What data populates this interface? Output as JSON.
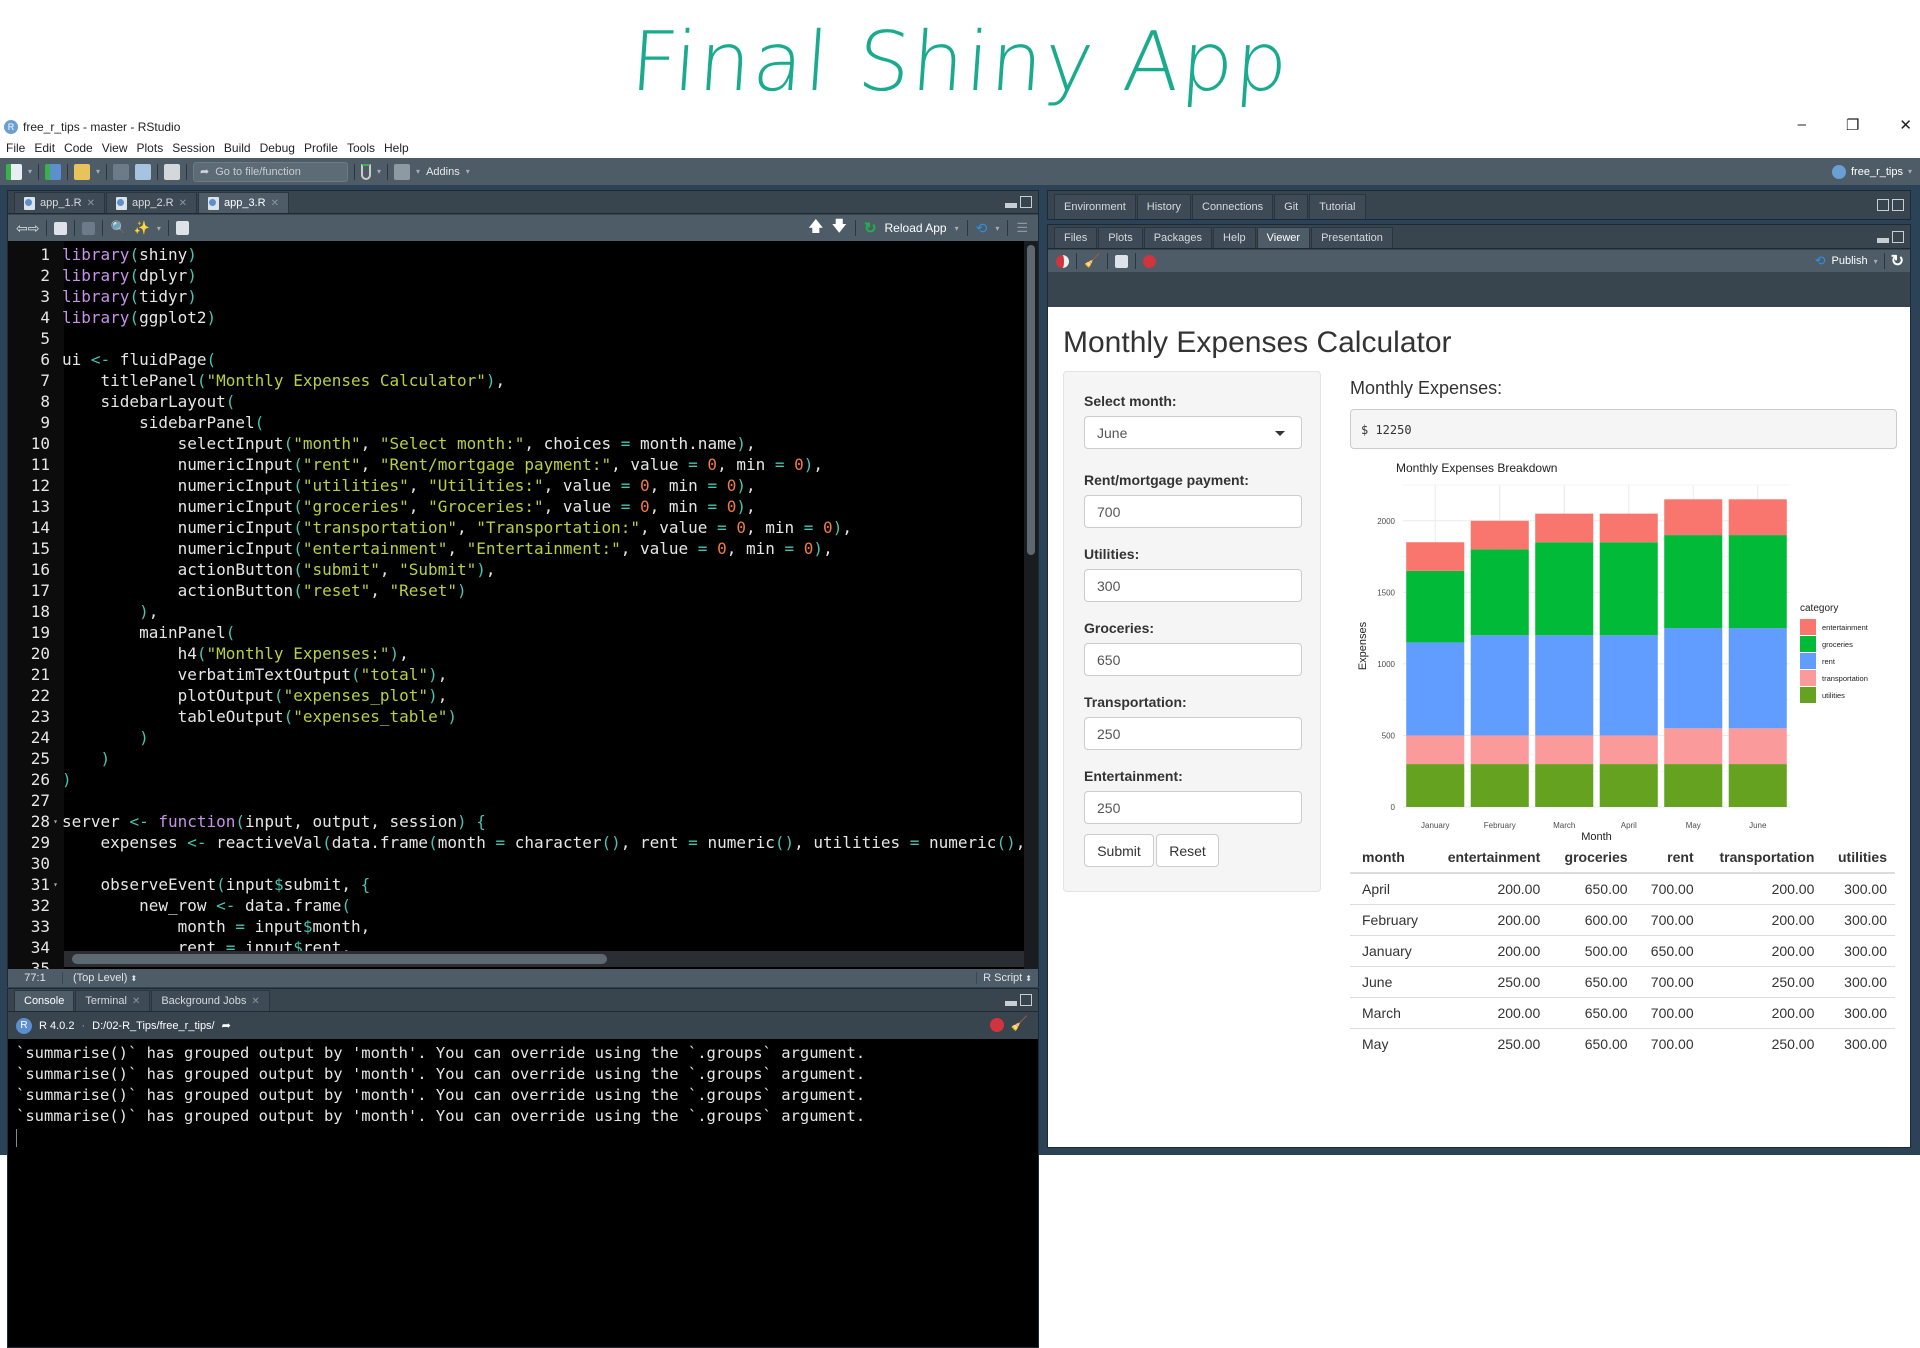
{
  "banner": {
    "text": "Final Shiny App"
  },
  "window": {
    "title": "free_r_tips - master - RStudio",
    "controls": {
      "minimize": "–",
      "restore": "❐",
      "close": "✕"
    }
  },
  "menu": [
    "File",
    "Edit",
    "Code",
    "View",
    "Plots",
    "Session",
    "Build",
    "Debug",
    "Profile",
    "Tools",
    "Help"
  ],
  "toolbar": {
    "goto_placeholder": "Go to file/function",
    "addins_label": "Addins",
    "project_label": "free_r_tips"
  },
  "editor": {
    "tabs": [
      {
        "label": "app_1.R",
        "active": false
      },
      {
        "label": "app_2.R",
        "active": false
      },
      {
        "label": "app_3.R",
        "active": true
      }
    ],
    "reload_label": "Reload App",
    "lines": [
      [
        [
          "kw",
          "library"
        ],
        [
          "pa",
          "("
        ],
        [
          "tx",
          "shiny"
        ],
        [
          "pa",
          ")"
        ]
      ],
      [
        [
          "kw",
          "library"
        ],
        [
          "pa",
          "("
        ],
        [
          "tx",
          "dplyr"
        ],
        [
          "pa",
          ")"
        ]
      ],
      [
        [
          "kw",
          "library"
        ],
        [
          "pa",
          "("
        ],
        [
          "tx",
          "tidyr"
        ],
        [
          "pa",
          ")"
        ]
      ],
      [
        [
          "kw",
          "library"
        ],
        [
          "pa",
          "("
        ],
        [
          "tx",
          "ggplot2"
        ],
        [
          "pa",
          ")"
        ]
      ],
      [],
      [
        [
          "tx",
          "ui "
        ],
        [
          "op",
          "<-"
        ],
        [
          "tx",
          " fluidPage"
        ],
        [
          "pa",
          "("
        ]
      ],
      [
        [
          "tx",
          "    titlePanel"
        ],
        [
          "pa",
          "("
        ],
        [
          "st",
          "\"Monthly Expenses Calculator\""
        ],
        [
          "pa",
          ")"
        ],
        [
          "tx",
          ","
        ]
      ],
      [
        [
          "tx",
          "    sidebarLayout"
        ],
        [
          "pa",
          "("
        ]
      ],
      [
        [
          "tx",
          "        sidebarPanel"
        ],
        [
          "pa",
          "("
        ]
      ],
      [
        [
          "tx",
          "            selectInput"
        ],
        [
          "pa",
          "("
        ],
        [
          "st",
          "\"month\""
        ],
        [
          "tx",
          ", "
        ],
        [
          "st",
          "\"Select month:\""
        ],
        [
          "tx",
          ", choices "
        ],
        [
          "op",
          "="
        ],
        [
          "tx",
          " month.name"
        ],
        [
          "pa",
          ")"
        ],
        [
          "tx",
          ","
        ]
      ],
      [
        [
          "tx",
          "            numericInput"
        ],
        [
          "pa",
          "("
        ],
        [
          "st",
          "\"rent\""
        ],
        [
          "tx",
          ", "
        ],
        [
          "st",
          "\"Rent/mortgage payment:\""
        ],
        [
          "tx",
          ", value "
        ],
        [
          "op",
          "="
        ],
        [
          "tx",
          " "
        ],
        [
          "nu",
          "0"
        ],
        [
          "tx",
          ", min "
        ],
        [
          "op",
          "="
        ],
        [
          "tx",
          " "
        ],
        [
          "nu",
          "0"
        ],
        [
          "pa",
          ")"
        ],
        [
          "tx",
          ","
        ]
      ],
      [
        [
          "tx",
          "            numericInput"
        ],
        [
          "pa",
          "("
        ],
        [
          "st",
          "\"utilities\""
        ],
        [
          "tx",
          ", "
        ],
        [
          "st",
          "\"Utilities:\""
        ],
        [
          "tx",
          ", value "
        ],
        [
          "op",
          "="
        ],
        [
          "tx",
          " "
        ],
        [
          "nu",
          "0"
        ],
        [
          "tx",
          ", min "
        ],
        [
          "op",
          "="
        ],
        [
          "tx",
          " "
        ],
        [
          "nu",
          "0"
        ],
        [
          "pa",
          ")"
        ],
        [
          "tx",
          ","
        ]
      ],
      [
        [
          "tx",
          "            numericInput"
        ],
        [
          "pa",
          "("
        ],
        [
          "st",
          "\"groceries\""
        ],
        [
          "tx",
          ", "
        ],
        [
          "st",
          "\"Groceries:\""
        ],
        [
          "tx",
          ", value "
        ],
        [
          "op",
          "="
        ],
        [
          "tx",
          " "
        ],
        [
          "nu",
          "0"
        ],
        [
          "tx",
          ", min "
        ],
        [
          "op",
          "="
        ],
        [
          "tx",
          " "
        ],
        [
          "nu",
          "0"
        ],
        [
          "pa",
          ")"
        ],
        [
          "tx",
          ","
        ]
      ],
      [
        [
          "tx",
          "            numericInput"
        ],
        [
          "pa",
          "("
        ],
        [
          "st",
          "\"transportation\""
        ],
        [
          "tx",
          ", "
        ],
        [
          "st",
          "\"Transportation:\""
        ],
        [
          "tx",
          ", value "
        ],
        [
          "op",
          "="
        ],
        [
          "tx",
          " "
        ],
        [
          "nu",
          "0"
        ],
        [
          "tx",
          ", min "
        ],
        [
          "op",
          "="
        ],
        [
          "tx",
          " "
        ],
        [
          "nu",
          "0"
        ],
        [
          "pa",
          ")"
        ],
        [
          "tx",
          ","
        ]
      ],
      [
        [
          "tx",
          "            numericInput"
        ],
        [
          "pa",
          "("
        ],
        [
          "st",
          "\"entertainment\""
        ],
        [
          "tx",
          ", "
        ],
        [
          "st",
          "\"Entertainment:\""
        ],
        [
          "tx",
          ", value "
        ],
        [
          "op",
          "="
        ],
        [
          "tx",
          " "
        ],
        [
          "nu",
          "0"
        ],
        [
          "tx",
          ", min "
        ],
        [
          "op",
          "="
        ],
        [
          "tx",
          " "
        ],
        [
          "nu",
          "0"
        ],
        [
          "pa",
          ")"
        ],
        [
          "tx",
          ","
        ]
      ],
      [
        [
          "tx",
          "            actionButton"
        ],
        [
          "pa",
          "("
        ],
        [
          "st",
          "\"submit\""
        ],
        [
          "tx",
          ", "
        ],
        [
          "st",
          "\"Submit\""
        ],
        [
          "pa",
          ")"
        ],
        [
          "tx",
          ","
        ]
      ],
      [
        [
          "tx",
          "            actionButton"
        ],
        [
          "pa",
          "("
        ],
        [
          "st",
          "\"reset\""
        ],
        [
          "tx",
          ", "
        ],
        [
          "st",
          "\"Reset\""
        ],
        [
          "pa",
          ")"
        ]
      ],
      [
        [
          "pa",
          "        )"
        ],
        [
          "tx",
          ","
        ]
      ],
      [
        [
          "tx",
          "        mainPanel"
        ],
        [
          "pa",
          "("
        ]
      ],
      [
        [
          "tx",
          "            h4"
        ],
        [
          "pa",
          "("
        ],
        [
          "st",
          "\"Monthly Expenses:\""
        ],
        [
          "pa",
          ")"
        ],
        [
          "tx",
          ","
        ]
      ],
      [
        [
          "tx",
          "            verbatimTextOutput"
        ],
        [
          "pa",
          "("
        ],
        [
          "st",
          "\"total\""
        ],
        [
          "pa",
          ")"
        ],
        [
          "tx",
          ","
        ]
      ],
      [
        [
          "tx",
          "            plotOutput"
        ],
        [
          "pa",
          "("
        ],
        [
          "st",
          "\"expenses_plot\""
        ],
        [
          "pa",
          ")"
        ],
        [
          "tx",
          ","
        ]
      ],
      [
        [
          "tx",
          "            tableOutput"
        ],
        [
          "pa",
          "("
        ],
        [
          "st",
          "\"expenses_table\""
        ],
        [
          "pa",
          ")"
        ]
      ],
      [
        [
          "pa",
          "        )"
        ]
      ],
      [
        [
          "pa",
          "    )"
        ]
      ],
      [
        [
          "pa",
          ")"
        ]
      ],
      [],
      [
        [
          "tx",
          "server "
        ],
        [
          "op",
          "<-"
        ],
        [
          "tx",
          " "
        ],
        [
          "kw",
          "function"
        ],
        [
          "pa",
          "("
        ],
        [
          "tx",
          "input, output, session"
        ],
        [
          "pa",
          ")"
        ],
        [
          "tx",
          " "
        ],
        [
          "pa",
          "{"
        ]
      ],
      [
        [
          "tx",
          "    expenses "
        ],
        [
          "op",
          "<-"
        ],
        [
          "tx",
          " reactiveVal"
        ],
        [
          "pa",
          "("
        ],
        [
          "tx",
          "data.frame"
        ],
        [
          "pa",
          "("
        ],
        [
          "tx",
          "month "
        ],
        [
          "op",
          "="
        ],
        [
          "tx",
          " character"
        ],
        [
          "pa",
          "()"
        ],
        [
          "tx",
          ", rent "
        ],
        [
          "op",
          "="
        ],
        [
          "tx",
          " numeric"
        ],
        [
          "pa",
          "()"
        ],
        [
          "tx",
          ", utilities "
        ],
        [
          "op",
          "="
        ],
        [
          "tx",
          " numeric"
        ],
        [
          "pa",
          "()"
        ],
        [
          "tx",
          ","
        ]
      ],
      [],
      [
        [
          "tx",
          "    observeEvent"
        ],
        [
          "pa",
          "("
        ],
        [
          "tx",
          "input"
        ],
        [
          "op",
          "$"
        ],
        [
          "tx",
          "submit, "
        ],
        [
          "pa",
          "{"
        ]
      ],
      [
        [
          "tx",
          "        new_row "
        ],
        [
          "op",
          "<-"
        ],
        [
          "tx",
          " data.frame"
        ],
        [
          "pa",
          "("
        ]
      ],
      [
        [
          "tx",
          "            month "
        ],
        [
          "op",
          "="
        ],
        [
          "tx",
          " input"
        ],
        [
          "op",
          "$"
        ],
        [
          "tx",
          "month,"
        ]
      ],
      [
        [
          "tx",
          "            rent "
        ],
        [
          "op",
          "="
        ],
        [
          "tx",
          " input"
        ],
        [
          "op",
          "$"
        ],
        [
          "tx",
          "rent,"
        ]
      ],
      []
    ],
    "fold_lines": [
      28,
      31
    ],
    "status": {
      "position": "77:1",
      "scope": "(Top Level)",
      "filetype": "R Script"
    }
  },
  "console": {
    "tabs": [
      {
        "label": "Console",
        "active": true,
        "closable": false
      },
      {
        "label": "Terminal",
        "active": false,
        "closable": true
      },
      {
        "label": "Background Jobs",
        "active": false,
        "closable": true
      }
    ],
    "r_version": "R 4.0.2",
    "path": "D:/02-R_Tips/free_r_tips/",
    "output": [
      "`summarise()` has grouped output by 'month'. You can override using the `.groups` argument.",
      "`summarise()` has grouped output by 'month'. You can override using the `.groups` argument.",
      "`summarise()` has grouped output by 'month'. You can override using the `.groups` argument.",
      "`summarise()` has grouped output by 'month'. You can override using the `.groups` argument."
    ]
  },
  "right_top_tabs": [
    "Environment",
    "History",
    "Connections",
    "Git",
    "Tutorial"
  ],
  "right_bottom_tabs": [
    {
      "label": "Files",
      "active": false
    },
    {
      "label": "Plots",
      "active": false
    },
    {
      "label": "Packages",
      "active": false
    },
    {
      "label": "Help",
      "active": false
    },
    {
      "label": "Viewer",
      "active": true
    },
    {
      "label": "Presentation",
      "active": false
    }
  ],
  "viewer": {
    "publish_label": "Publish"
  },
  "shiny_app": {
    "title": "Monthly Expenses Calculator",
    "sidebar": {
      "select_label": "Select month:",
      "select_value": "June",
      "fields": [
        {
          "label": "Rent/mortgage payment:",
          "value": "700"
        },
        {
          "label": "Utilities:",
          "value": "300"
        },
        {
          "label": "Groceries:",
          "value": "650"
        },
        {
          "label": "Transportation:",
          "value": "250"
        },
        {
          "label": "Entertainment:",
          "value": "250"
        }
      ],
      "submit_label": "Submit",
      "reset_label": "Reset"
    },
    "main": {
      "heading": "Monthly Expenses:",
      "total": "$ 12250"
    },
    "table": {
      "columns": [
        "month",
        "entertainment",
        "groceries",
        "rent",
        "transportation",
        "utilities"
      ],
      "rows": [
        [
          "April",
          "200.00",
          "650.00",
          "700.00",
          "200.00",
          "300.00"
        ],
        [
          "February",
          "200.00",
          "600.00",
          "700.00",
          "200.00",
          "300.00"
        ],
        [
          "January",
          "200.00",
          "500.00",
          "650.00",
          "200.00",
          "300.00"
        ],
        [
          "June",
          "250.00",
          "650.00",
          "700.00",
          "250.00",
          "300.00"
        ],
        [
          "March",
          "200.00",
          "650.00",
          "700.00",
          "200.00",
          "300.00"
        ],
        [
          "May",
          "250.00",
          "650.00",
          "700.00",
          "250.00",
          "300.00"
        ]
      ]
    }
  },
  "chart_data": {
    "type": "bar",
    "stacked": true,
    "title": "Monthly Expenses Breakdown",
    "xlabel": "Month",
    "ylabel": "Expenses",
    "categories": [
      "January",
      "February",
      "March",
      "April",
      "May",
      "June"
    ],
    "series": [
      {
        "name": "utilities",
        "color": "#65a21f",
        "values": [
          300,
          300,
          300,
          300,
          300,
          300
        ]
      },
      {
        "name": "transportation",
        "color": "#fa9a9a",
        "values": [
          200,
          200,
          200,
          200,
          250,
          250
        ]
      },
      {
        "name": "rent",
        "color": "#619cff",
        "values": [
          650,
          700,
          700,
          700,
          700,
          700
        ]
      },
      {
        "name": "groceries",
        "color": "#00ba38",
        "values": [
          500,
          600,
          650,
          650,
          650,
          650
        ]
      },
      {
        "name": "entertainment",
        "color": "#f8766d",
        "values": [
          200,
          200,
          200,
          200,
          250,
          250
        ]
      }
    ],
    "legend": {
      "title": "category",
      "position": "right",
      "order": [
        "entertainment",
        "groceries",
        "rent",
        "transportation",
        "utilities"
      ]
    },
    "yticks": [
      0,
      500,
      1000,
      1500,
      2000
    ],
    "ylim": [
      0,
      2250
    ],
    "grid": true
  }
}
